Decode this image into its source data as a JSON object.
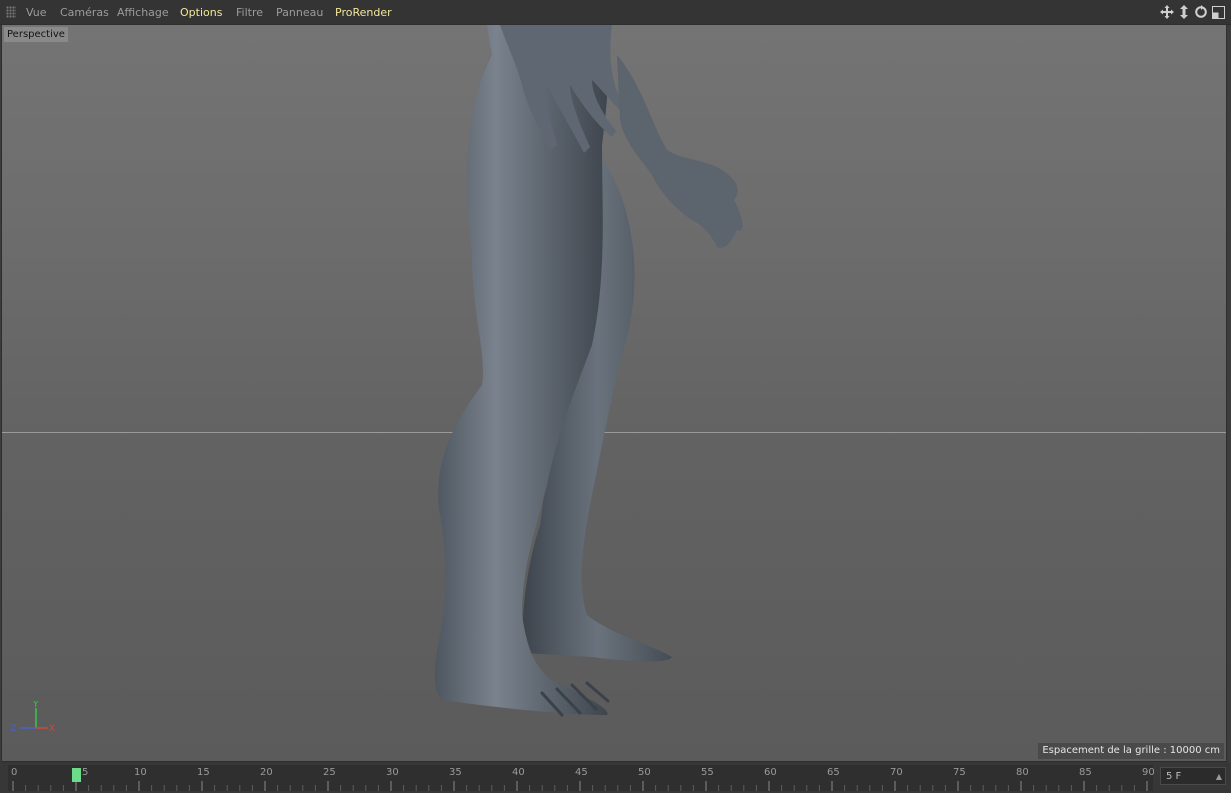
{
  "menubar": {
    "items": [
      {
        "label": "Vue"
      },
      {
        "label": "Caméras"
      },
      {
        "label": "Affichage"
      },
      {
        "label": "Options"
      },
      {
        "label": "Filtre"
      },
      {
        "label": "Panneau"
      },
      {
        "label": "ProRender"
      }
    ],
    "highlight_color": "#f2e79b",
    "nav_icons": [
      "move-view-icon",
      "zoom-view-icon",
      "rotate-view-icon",
      "toggle-panel-icon"
    ]
  },
  "viewport": {
    "camera_label": "Perspective",
    "grid_spacing_label": "Espacement de la grille : 10000 cm",
    "axis": {
      "x": "X",
      "y": "Y",
      "z": "Z"
    }
  },
  "timeline": {
    "ticks": [
      "0",
      "5",
      "10",
      "15",
      "20",
      "25",
      "30",
      "35",
      "40",
      "45",
      "50",
      "55",
      "60",
      "65",
      "70",
      "75",
      "80",
      "85",
      "90"
    ],
    "current_frame": 5,
    "frame_field": "5 F",
    "playhead_color": "#6ddc8a"
  }
}
